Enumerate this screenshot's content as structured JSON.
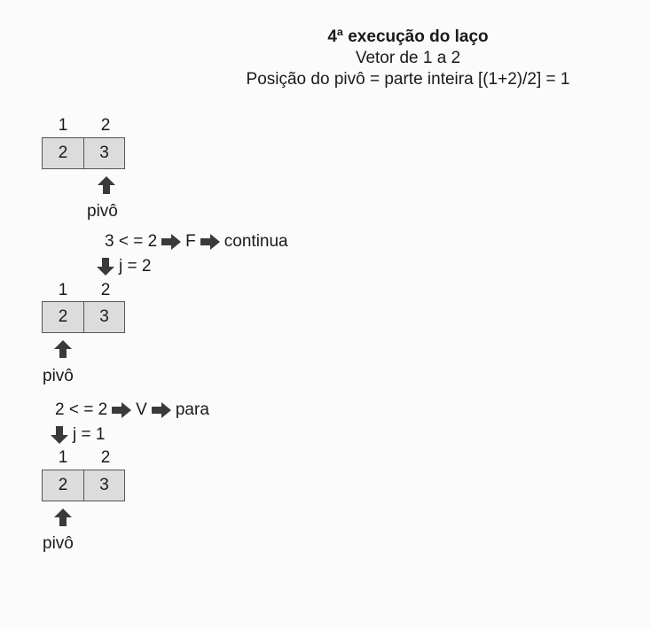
{
  "header": {
    "title": "4ª execução do laço",
    "subtitle": "Vetor de 1 a 2",
    "pivot_formula": "Posição do pivô = parte inteira [(1+2)/2] = 1"
  },
  "blocks": [
    {
      "indices": [
        "1",
        "2"
      ],
      "cells": [
        "2",
        "3"
      ],
      "pivot_label": "pivô"
    },
    {
      "indices": [
        "1",
        "2"
      ],
      "cells": [
        "2",
        "3"
      ],
      "pivot_label": "pivô"
    },
    {
      "indices": [
        "1",
        "2"
      ],
      "cells": [
        "2",
        "3"
      ],
      "pivot_label": "pivô"
    }
  ],
  "steps": [
    {
      "comparison": "3 < = 2",
      "result": "F",
      "action": "continua",
      "j": "j = 2"
    },
    {
      "comparison": "2 < = 2",
      "result": "V",
      "action": "para",
      "j": "j = 1"
    }
  ],
  "colors": {
    "cell_fill": "#dcdcdc",
    "arrow": "#3a3a3a",
    "text": "#1a1a1a"
  }
}
